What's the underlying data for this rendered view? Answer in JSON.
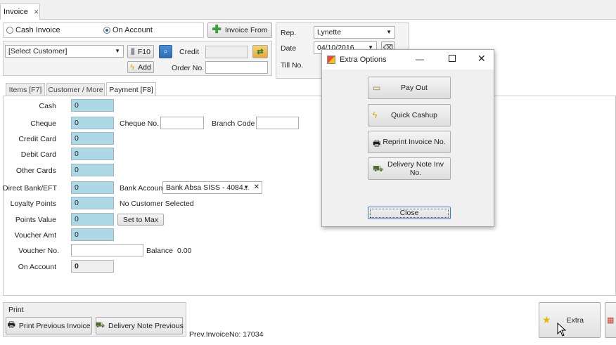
{
  "doc_tab": {
    "label": "Invoice",
    "close": "✕"
  },
  "invoice_type": {
    "cash": "Cash Invoice",
    "on_account": "On Account"
  },
  "invoice_from_button": "Invoice From",
  "customer": {
    "select_value": "[Select Customer]",
    "f10_button": "F10",
    "add_button": "Add",
    "credit_label": "Credit",
    "order_label": "Order No."
  },
  "header_right": {
    "rep_label": "Rep.",
    "rep_value": "Lynette",
    "date_label": "Date",
    "date_value": "04/10/2016",
    "till_label": "Till No."
  },
  "tabs": [
    {
      "label": "Items [F7]"
    },
    {
      "label": "Customer / More"
    },
    {
      "label": "Payment [F8]"
    }
  ],
  "payment": {
    "cash_label": "Cash",
    "cash_value": "0",
    "cheque_label": "Cheque",
    "cheque_value": "0",
    "cheque_no_label": "Cheque No.",
    "branch_code_label": "Branch Code",
    "credit_card_label": "Credit Card",
    "credit_card_value": "0",
    "debit_card_label": "Debit Card",
    "debit_card_value": "0",
    "other_cards_label": "Other Cards",
    "other_cards_value": "0",
    "direct_bank_label": "Direct Bank/EFT",
    "direct_bank_value": "0",
    "bank_account_label": "Bank Account",
    "bank_account_value": "Bank Absa SISS - 4084...",
    "loyalty_label": "Loyalty Points",
    "loyalty_value": "0",
    "loyalty_note": "No Customer Selected",
    "points_value_label": "Points Value",
    "points_value_value": "0",
    "set_to_max_button": "Set to Max",
    "voucher_amt_label": "Voucher Amt",
    "voucher_amt_value": "0",
    "voucher_no_label": "Voucher No.",
    "balance_label": "Balance",
    "balance_value": "0.00",
    "on_account_label": "On Account",
    "on_account_value": "0"
  },
  "print_group": {
    "title": "Print",
    "print_previous_button": "Print Previous Invoice",
    "delivery_note_previous_button": "Delivery Note Previous"
  },
  "prev_invoice": "Prev.InvoiceNo: 17034",
  "extra_button": "Extra",
  "dialog": {
    "title": "Extra Options",
    "buttons": [
      {
        "label": "Pay Out"
      },
      {
        "label": "Quick Cashup"
      },
      {
        "label": "Reprint Invoice No."
      },
      {
        "label": "Delivery Note Inv No."
      }
    ],
    "close_button": "Close"
  },
  "colors": {
    "field_blue": "#add8e6",
    "accent_green": "#3a9d3a",
    "focus_blue": "#3a7bd5"
  }
}
